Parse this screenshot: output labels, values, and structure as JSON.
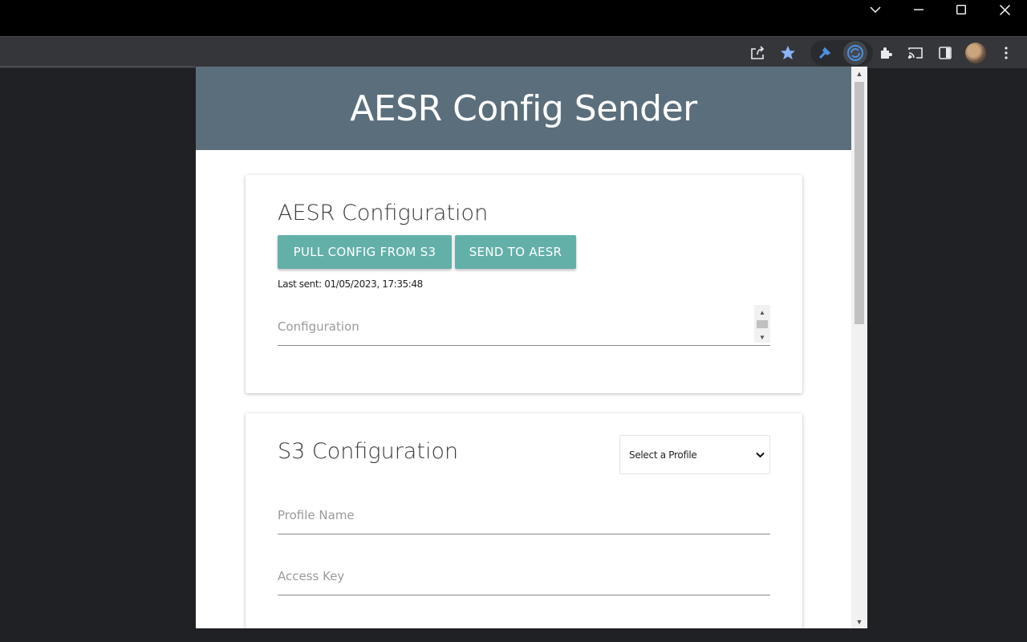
{
  "app": {
    "title": "AESR Config Sender"
  },
  "aesr_card": {
    "title": "AESR Configuration",
    "pull_button": "PULL CONFIG FROM S3",
    "send_button": "SEND TO AESR",
    "last_sent": "Last sent: 01/05/2023, 17:35:48",
    "config_placeholder": "Configuration"
  },
  "s3_card": {
    "title": "S3 Configuration",
    "profile_select": "Select a Profile",
    "profile_name_placeholder": "Profile Name",
    "access_key_placeholder": "Access Key"
  },
  "icons": {
    "window_controls": [
      "chevron-down-icon",
      "minimize-icon",
      "maximize-icon",
      "close-icon"
    ],
    "toolbar": [
      "share-icon",
      "bookmark-star-icon",
      "extension-aesr-icon",
      "extension-sync-icon",
      "puzzle-icon",
      "cast-icon",
      "side-panel-icon",
      "avatar",
      "more-icon"
    ]
  },
  "colors": {
    "header_bg": "#5b6e7b",
    "button_bg": "#63b0a9",
    "bookmark_star": "#8ab4f8",
    "extension_accent": "#4a90e2"
  }
}
